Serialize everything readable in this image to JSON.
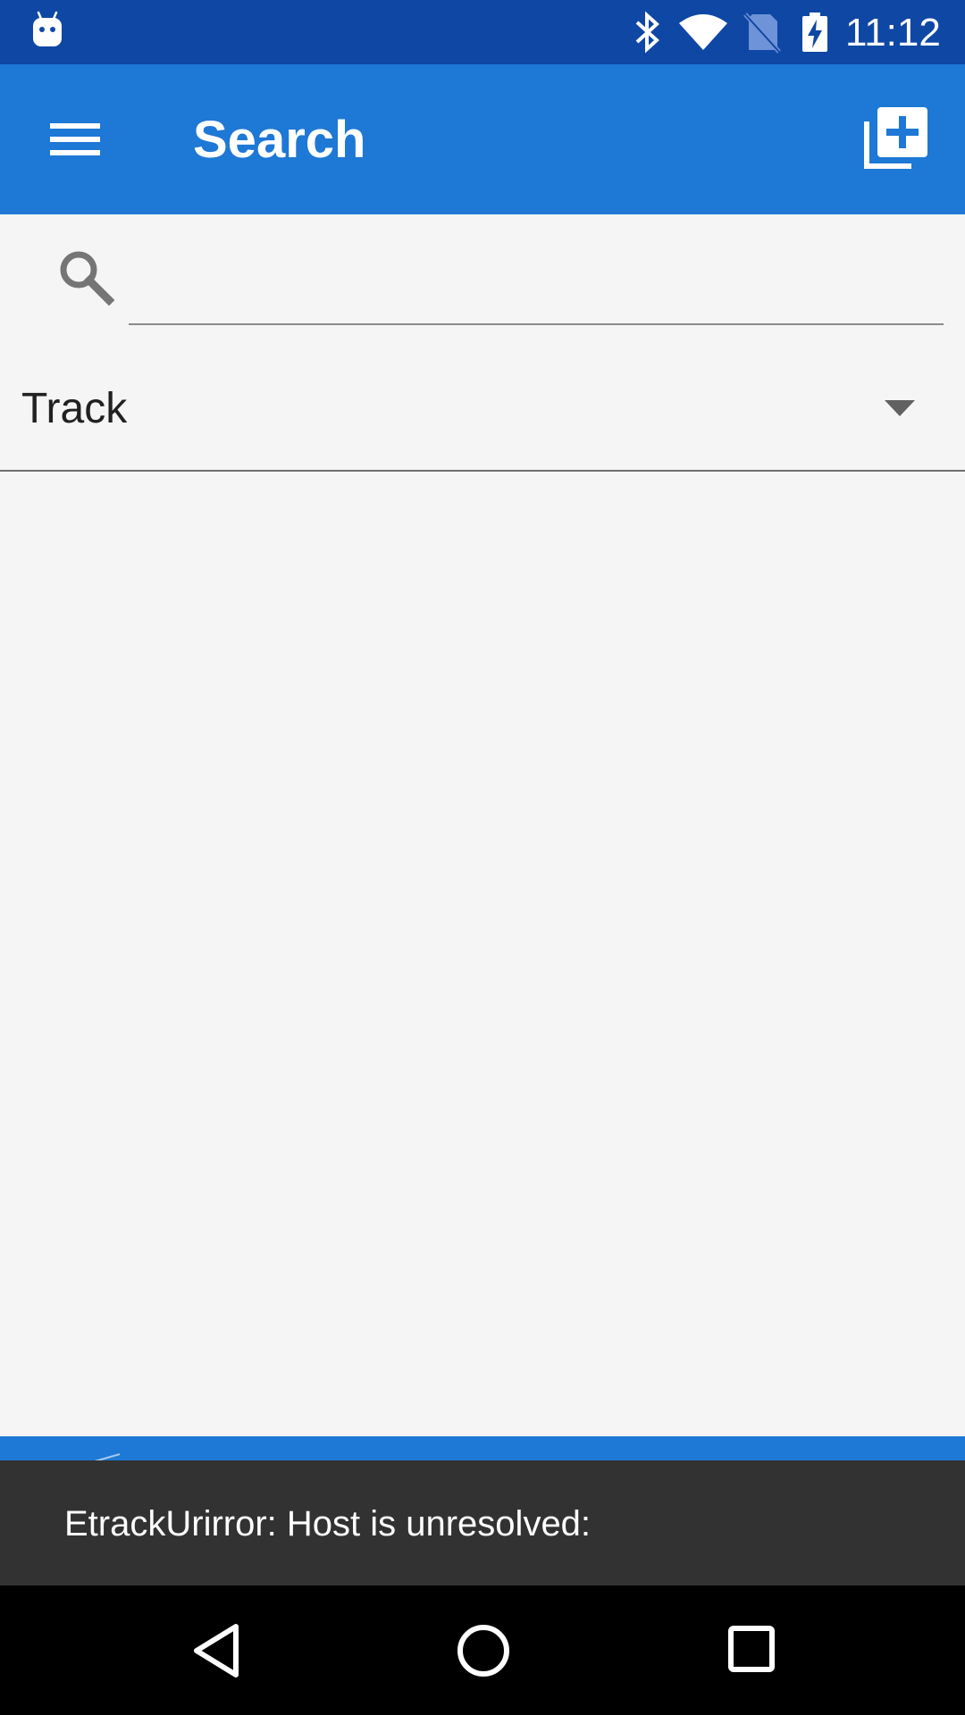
{
  "status_bar": {
    "time": "11:12",
    "icons": [
      "android-notification-icon",
      "bluetooth-icon",
      "wifi-icon",
      "no-sim-icon",
      "battery-charging-icon"
    ]
  },
  "app_bar": {
    "title": "Search",
    "menu_icon": "hamburger-menu-icon",
    "action_icon": "add-to-library-icon",
    "color": "#1e78d5"
  },
  "search": {
    "icon": "search-icon",
    "value": "",
    "placeholder": ""
  },
  "spinner": {
    "selected": "Track",
    "icon": "dropdown-arrow-icon"
  },
  "snackbar": {
    "message": "EtrackUrirror: Host is unresolved:"
  },
  "nav_bar": {
    "icons": [
      "back-icon",
      "home-icon",
      "recents-icon"
    ]
  },
  "colors": {
    "status_bar": "#0f47a4",
    "accent": "#1e78d5",
    "snackbar": "#323232",
    "background": "#f5f5f5"
  }
}
